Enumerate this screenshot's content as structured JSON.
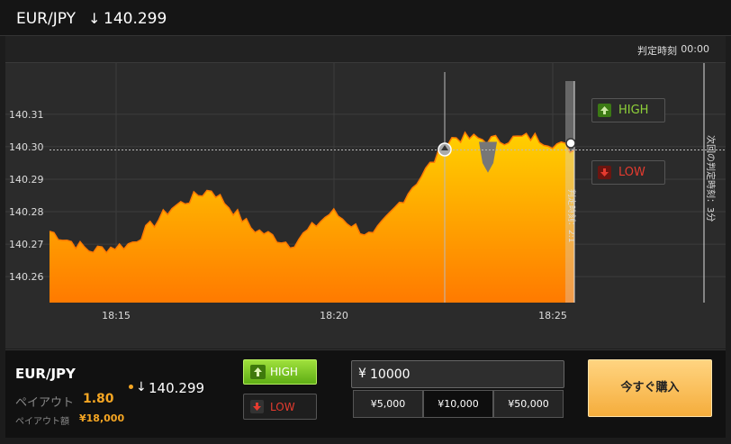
{
  "header": {
    "pair": "EUR/JPY",
    "arrow": "↓",
    "price": "140.299"
  },
  "judge": {
    "label": "判定時刻",
    "time": "00:00"
  },
  "chart": {
    "y_ticks": [
      "140.31",
      "140.30",
      "140.29",
      "140.28",
      "140.27",
      "140.26"
    ],
    "x_ticks": [
      "18:15",
      "18:20",
      "18:25"
    ],
    "current_price": "140.299",
    "vertical_label_1": "判定時刻：2:1",
    "vertical_label_2": "次回の判定時刻：3分",
    "fill_top": "#ffd000",
    "fill_bottom": "#ff7a00",
    "line_color": "#ff7a00"
  },
  "side": {
    "high_label": "HIGH",
    "low_label": "LOW",
    "high_color": "#8fd13a",
    "low_color": "#e53b2f"
  },
  "bottom": {
    "pair": "EUR/JPY",
    "payout_label": "ペイアウト",
    "payout_value": "1.80",
    "amount_label": "ペイアウト額",
    "amount_value": "¥18,000",
    "arrow": "↓",
    "price": "140.299",
    "high_label": "HIGH",
    "low_label": "LOW",
    "currency": "¥",
    "amount_input": "10000",
    "presets": [
      "¥5,000",
      "¥10,000",
      "¥50,000"
    ],
    "buy_label": "今すぐ購入"
  },
  "chart_data": {
    "type": "area",
    "x": [
      "18:13",
      "18:14",
      "18:15",
      "18:16",
      "18:17",
      "18:18",
      "18:19",
      "18:20",
      "18:21",
      "18:22",
      "18:23",
      "18:24",
      "18:25",
      "18:25:30"
    ],
    "y_range": [
      140.252,
      140.323
    ],
    "series": [
      {
        "values": [
          140.274,
          140.268,
          140.27,
          140.281,
          140.287,
          140.275,
          140.27,
          140.28,
          140.272,
          140.288,
          140.303,
          140.302,
          140.303,
          140.299
        ]
      }
    ]
  }
}
